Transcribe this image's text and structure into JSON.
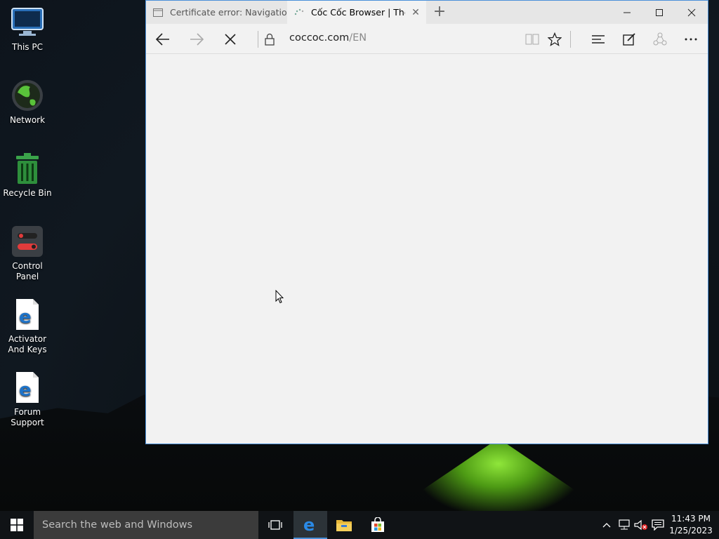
{
  "desktop": {
    "icons": [
      {
        "label": "This PC"
      },
      {
        "label": "Network"
      },
      {
        "label": "Recycle Bin"
      },
      {
        "label": "Control Panel"
      },
      {
        "label": "Activator And Keys"
      },
      {
        "label": "Forum Support"
      }
    ]
  },
  "browser": {
    "tabs": [
      {
        "title": "Certificate error: Navigation blocked",
        "icon": "page-icon"
      },
      {
        "title": "Cốc Cốc Browser | The web browser",
        "icon": "loading-icon"
      }
    ],
    "address": {
      "host": "coccoc.com",
      "path": "/EN"
    },
    "accent": "#4a90d9"
  },
  "taskbar": {
    "search_placeholder": "Search the web and Windows",
    "time": "11:43 PM",
    "date": "1/25/2023"
  }
}
